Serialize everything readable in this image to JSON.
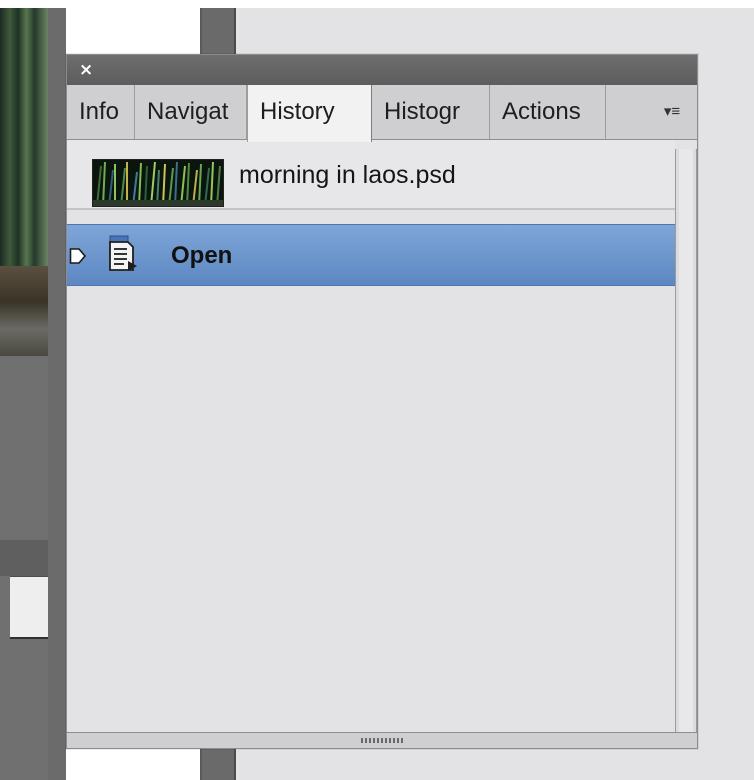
{
  "panel": {
    "close_glyph": "×",
    "tabs": [
      {
        "label": "Info",
        "active": false
      },
      {
        "label": "Navigat",
        "active": false
      },
      {
        "label": "History",
        "active": true
      },
      {
        "label": "Histogr",
        "active": false
      },
      {
        "label": "Actions",
        "active": false
      }
    ],
    "menu_glyph": "▾≡",
    "snapshot": {
      "label": "morning in laos.psd",
      "thumbnail_icon": "image-thumbnail"
    },
    "history_states": [
      {
        "label": "Open",
        "selected": true,
        "icon": "document-open-icon",
        "marker": "state-marker-icon"
      }
    ]
  },
  "colors": {
    "selection": "#6b94cc",
    "panel_bg": "#e3e3e5",
    "title_bar": "#666666"
  }
}
